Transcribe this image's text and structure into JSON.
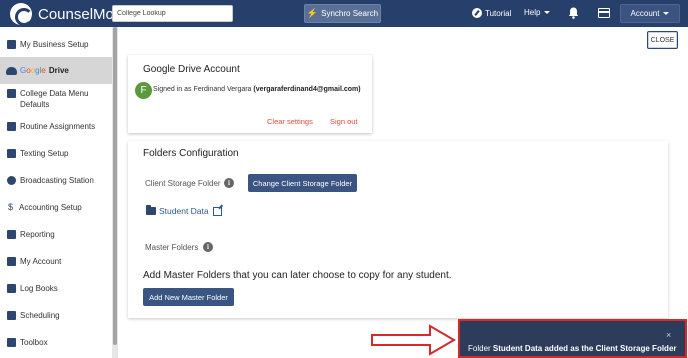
{
  "header": {
    "brand": "CounselMore",
    "search_placeholder": "College Lookup",
    "synchro_label": "Synchro Search",
    "tutorial_label": "Tutorial",
    "help_label": "Help",
    "account_label": "Account"
  },
  "sidebar": {
    "items": [
      {
        "label": "My Business Setup"
      },
      {
        "label": "Drive"
      },
      {
        "label": "College Data Menu Defaults"
      },
      {
        "label": "Routine Assignments"
      },
      {
        "label": "Texting Setup"
      },
      {
        "label": "Broadcasting Station"
      },
      {
        "label": "Accounting Setup"
      },
      {
        "label": "Reporting"
      },
      {
        "label": "My Account"
      },
      {
        "label": "Log Books"
      },
      {
        "label": "Scheduling"
      },
      {
        "label": "Toolbox"
      }
    ],
    "google_word": [
      "G",
      "o",
      "o",
      "g",
      "l",
      "e"
    ]
  },
  "main": {
    "close_label": "CLOSE",
    "drive_account": {
      "title": "Google Drive Account",
      "avatar_letter": "F",
      "signed_in_prefix": "Signed in as Ferdinand Vergara",
      "email": "(vergaraferdinand4@gmail.com)",
      "clear_settings": "Clear settings",
      "sign_out": "Sign out"
    },
    "folders": {
      "title": "Folders Configuration",
      "client_storage_label": "Client Storage Folder",
      "change_button": "Change Client Storage Folder",
      "student_data_link": "Student Data",
      "master_folders_label": "Master Folders",
      "add_text": "Add Master Folders that you can later choose to copy for any student.",
      "add_button": "Add New Master Folder"
    }
  },
  "toast": {
    "close": "×",
    "prefix": "Folder",
    "message": "Student Data added as the Client Storage Folder"
  },
  "colors": {
    "header_bg": "#273f6b",
    "button_blue": "#3a5582",
    "link_red": "#e04a3c",
    "toast_bg": "#2c3c5a",
    "highlight_border": "#d62a2a"
  }
}
